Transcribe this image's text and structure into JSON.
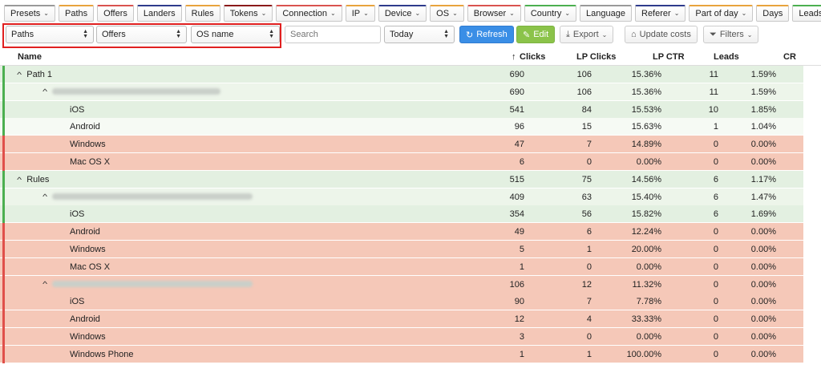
{
  "tabs": [
    {
      "label": "Presets",
      "dropdown": true,
      "color": "#999999"
    },
    {
      "label": "Paths",
      "dropdown": false,
      "color": "#e8a33d"
    },
    {
      "label": "Offers",
      "dropdown": false,
      "color": "#d9534f"
    },
    {
      "label": "Landers",
      "dropdown": false,
      "color": "#2e3b8c"
    },
    {
      "label": "Rules",
      "dropdown": false,
      "color": "#e8a33d"
    },
    {
      "label": "Tokens",
      "dropdown": true,
      "color": "#8b1a1a"
    },
    {
      "label": "Connection",
      "dropdown": true,
      "color": "#d9534f"
    },
    {
      "label": "IP",
      "dropdown": true,
      "color": "#e8a33d"
    },
    {
      "label": "Device",
      "dropdown": true,
      "color": "#2e3b8c"
    },
    {
      "label": "OS",
      "dropdown": true,
      "color": "#e8a33d"
    },
    {
      "label": "Browser",
      "dropdown": true,
      "color": "#d9534f"
    },
    {
      "label": "Country",
      "dropdown": true,
      "color": "#4caf50"
    },
    {
      "label": "Language",
      "dropdown": false,
      "color": "#999999"
    },
    {
      "label": "Referer",
      "dropdown": true,
      "color": "#2e3b8c"
    },
    {
      "label": "Part of day",
      "dropdown": true,
      "color": "#e8a33d"
    },
    {
      "label": "Days",
      "dropdown": false,
      "color": "#e8a33d"
    },
    {
      "label": "Leads",
      "dropdown": false,
      "color": "#4caf50"
    }
  ],
  "toolbar": {
    "group1": "Paths",
    "group2": "Offers",
    "group3": "OS name",
    "search_placeholder": "Search",
    "date_range": "Today",
    "refresh_label": "Refresh",
    "edit_label": "Edit",
    "export_label": "Export",
    "update_costs_label": "Update costs",
    "filters_label": "Filters"
  },
  "table": {
    "columns": {
      "name": "Name",
      "clicks": "Clicks",
      "lp_clicks": "LP Clicks",
      "lp_ctr": "LP CTR",
      "leads": "Leads",
      "cr": "CR"
    },
    "sort_icon": "arrow-up-icon",
    "rows": [
      {
        "level": 0,
        "name": "Path 1",
        "blurred": false,
        "expanded": true,
        "clicks": "690",
        "lp_clicks": "106",
        "lp_ctr": "15.36%",
        "leads": "11",
        "cr": "1.59%",
        "status": "green"
      },
      {
        "level": 1,
        "name": "",
        "blurred": true,
        "expanded": true,
        "clicks": "690",
        "lp_clicks": "106",
        "lp_ctr": "15.36%",
        "leads": "11",
        "cr": "1.59%",
        "status": "green"
      },
      {
        "level": 2,
        "name": "iOS",
        "blurred": false,
        "clicks": "541",
        "lp_clicks": "84",
        "lp_ctr": "15.53%",
        "leads": "10",
        "cr": "1.85%",
        "status": "green"
      },
      {
        "level": 2,
        "name": "Android",
        "blurred": false,
        "clicks": "96",
        "lp_clicks": "15",
        "lp_ctr": "15.63%",
        "leads": "1",
        "cr": "1.04%",
        "status": "green-light"
      },
      {
        "level": 2,
        "name": "Windows",
        "blurred": false,
        "clicks": "47",
        "lp_clicks": "7",
        "lp_ctr": "14.89%",
        "leads": "0",
        "cr": "0.00%",
        "status": "red"
      },
      {
        "level": 2,
        "name": "Mac OS X",
        "blurred": false,
        "clicks": "6",
        "lp_clicks": "0",
        "lp_ctr": "0.00%",
        "leads": "0",
        "cr": "0.00%",
        "status": "red"
      },
      {
        "level": 0,
        "name": "Rules",
        "blurred": false,
        "expanded": true,
        "clicks": "515",
        "lp_clicks": "75",
        "lp_ctr": "14.56%",
        "leads": "6",
        "cr": "1.17%",
        "status": "green"
      },
      {
        "level": 1,
        "name": "",
        "blurred": true,
        "expanded": true,
        "clicks": "409",
        "lp_clicks": "63",
        "lp_ctr": "15.40%",
        "leads": "6",
        "cr": "1.47%",
        "status": "green"
      },
      {
        "level": 2,
        "name": "iOS",
        "blurred": false,
        "clicks": "354",
        "lp_clicks": "56",
        "lp_ctr": "15.82%",
        "leads": "6",
        "cr": "1.69%",
        "status": "green"
      },
      {
        "level": 2,
        "name": "Android",
        "blurred": false,
        "clicks": "49",
        "lp_clicks": "6",
        "lp_ctr": "12.24%",
        "leads": "0",
        "cr": "0.00%",
        "status": "red"
      },
      {
        "level": 2,
        "name": "Windows",
        "blurred": false,
        "clicks": "5",
        "lp_clicks": "1",
        "lp_ctr": "20.00%",
        "leads": "0",
        "cr": "0.00%",
        "status": "red"
      },
      {
        "level": 2,
        "name": "Mac OS X",
        "blurred": false,
        "clicks": "1",
        "lp_clicks": "0",
        "lp_ctr": "0.00%",
        "leads": "0",
        "cr": "0.00%",
        "status": "red"
      },
      {
        "level": 1,
        "name": "",
        "blurred": true,
        "expanded": true,
        "clicks": "106",
        "lp_clicks": "12",
        "lp_ctr": "11.32%",
        "leads": "0",
        "cr": "0.00%",
        "status": "red"
      },
      {
        "level": 2,
        "name": "iOS",
        "blurred": false,
        "clicks": "90",
        "lp_clicks": "7",
        "lp_ctr": "7.78%",
        "leads": "0",
        "cr": "0.00%",
        "status": "red"
      },
      {
        "level": 2,
        "name": "Android",
        "blurred": false,
        "clicks": "12",
        "lp_clicks": "4",
        "lp_ctr": "33.33%",
        "leads": "0",
        "cr": "0.00%",
        "status": "red"
      },
      {
        "level": 2,
        "name": "Windows",
        "blurred": false,
        "clicks": "3",
        "lp_clicks": "0",
        "lp_ctr": "0.00%",
        "leads": "0",
        "cr": "0.00%",
        "status": "red"
      },
      {
        "level": 2,
        "name": "Windows Phone",
        "blurred": false,
        "clicks": "1",
        "lp_clicks": "1",
        "lp_ctr": "100.00%",
        "leads": "0",
        "cr": "0.00%",
        "status": "red"
      }
    ]
  }
}
